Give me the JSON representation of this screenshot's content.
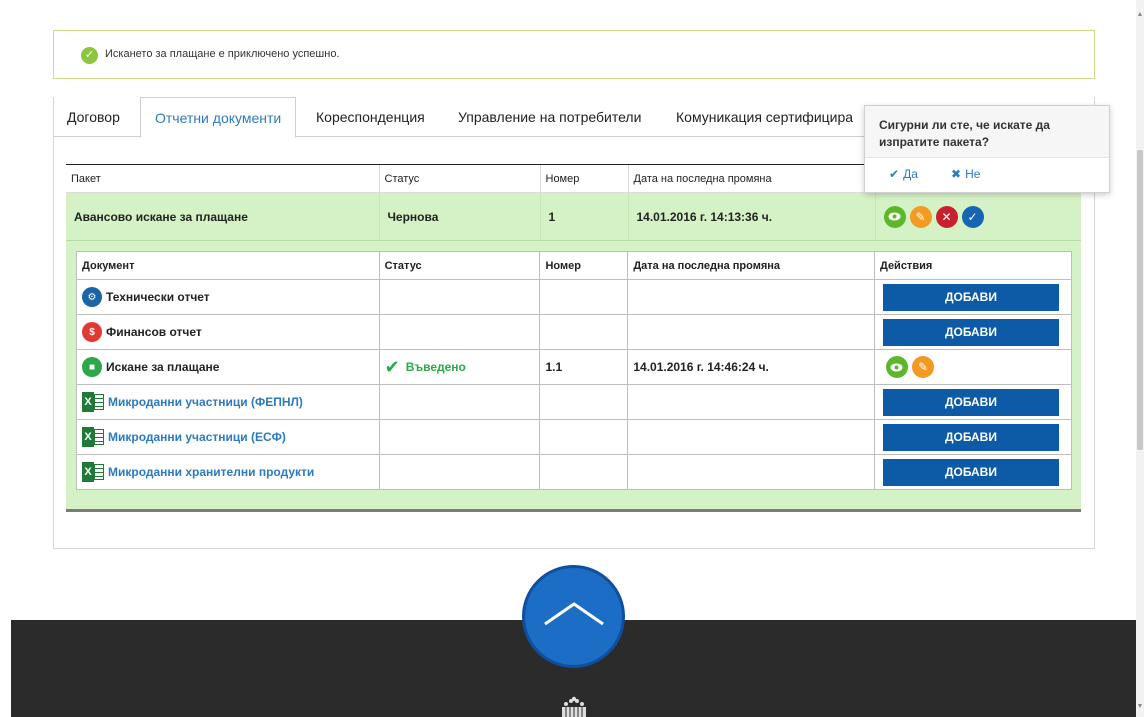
{
  "alert": {
    "message": "Искането за плащане е приключено успешно."
  },
  "tabs": [
    {
      "label": "Договор"
    },
    {
      "label": "Отчетни документи"
    },
    {
      "label": "Кореспонденция"
    },
    {
      "label": "Управление на потребители"
    },
    {
      "label": "Комуникация сертифицира"
    }
  ],
  "package_table": {
    "headers": {
      "package": "Пакет",
      "status": "Статус",
      "number": "Номер",
      "date": "Дата на последна промяна"
    },
    "row": {
      "package": "Авансово искане за плащане",
      "status": "Чернова",
      "number": "1",
      "date": "14.01.2016 г. 14:13:36 ч."
    }
  },
  "doc_table": {
    "headers": {
      "document": "Документ",
      "status": "Статус",
      "number": "Номер",
      "date": "Дата на последна промяна",
      "actions": "Действия"
    },
    "rows": [
      {
        "document": "Технически отчет",
        "status": "",
        "number": "",
        "date": "",
        "action": "ДОБАВИ"
      },
      {
        "document": "Финансов отчет",
        "status": "",
        "number": "",
        "date": "",
        "action": "ДОБАВИ"
      },
      {
        "document": "Искане за плащане",
        "status": "Въведено",
        "number": "1.1",
        "date": "14.01.2016 г. 14:46:24 ч.",
        "action": ""
      },
      {
        "document": "Микроданни участници (ФЕПНЛ)",
        "status": "",
        "number": "",
        "date": "",
        "action": "ДОБАВИ"
      },
      {
        "document": "Микроданни участници (ЕСФ)",
        "status": "",
        "number": "",
        "date": "",
        "action": "ДОБАВИ"
      },
      {
        "document": "Микроданни хранителни продукти",
        "status": "",
        "number": "",
        "date": "",
        "action": "ДОБАВИ"
      }
    ]
  },
  "popover": {
    "question": "Сигурни ли сте, че искате да изпратите пакета?",
    "yes": "Да",
    "no": "Не"
  },
  "icons": {
    "alert": "check-circle",
    "view": "eye",
    "edit": "pencil",
    "delete": "times",
    "send": "check",
    "scroll_top": "chevron-up"
  },
  "colors": {
    "accent": "#2c7abf",
    "button": "#0d5aa7",
    "row_highlight": "#d5f2c7",
    "footer": "#2b2b2b"
  }
}
